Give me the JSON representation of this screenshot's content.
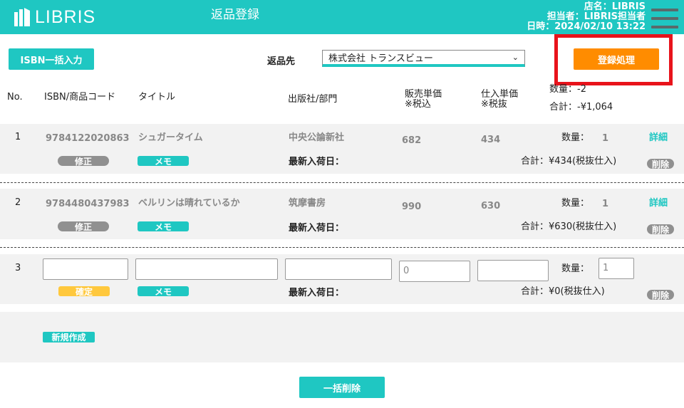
{
  "header": {
    "logo_text": "LIBRIS",
    "title": "返品登録",
    "store": "店名：LIBRIS",
    "staff": "担当者：LIBRIS担当者",
    "datetime": "日時：2024/02/10  13:22"
  },
  "controls": {
    "isbn_bulk_label": "ISBN一括入力",
    "return_to_label": "返品先",
    "return_to_value": "株式会社 トランスビュー",
    "register_label": "登録処理"
  },
  "summary": {
    "quantity": "数量：-2",
    "total": "合計：-¥1,064"
  },
  "columns": {
    "no": "No.",
    "isbn": "ISBN/商品コード",
    "title": "タイトル",
    "publisher": "出版社/部門",
    "sale_price_1": "販売単価",
    "sale_price_2": "※税込",
    "cost_price_1": "仕入単価",
    "cost_price_2": "※税抜"
  },
  "labels": {
    "edit": "修正",
    "memo": "メモ",
    "confirm": "確定",
    "latest_arrival": "最新入荷日：",
    "quantity": "数量：",
    "detail": "詳細",
    "delete": "削除"
  },
  "rows": [
    {
      "no": "1",
      "isbn": "9784122020863",
      "title": "シュガータイム",
      "publisher": "中央公論新社",
      "sale_price": "682",
      "cost_price": "434",
      "qty": "1",
      "total": "合計：¥434(税抜仕入)"
    },
    {
      "no": "2",
      "isbn": "9784480437983",
      "title": "ベルリンは晴れているか",
      "publisher": "筑摩書房",
      "sale_price": "990",
      "cost_price": "630",
      "qty": "1",
      "total": "合計：¥630(税抜仕入)"
    }
  ],
  "new_row": {
    "no": "3",
    "sale_price_value": "0",
    "qty_value": "1",
    "total": "合計：¥0(税抜仕入)"
  },
  "footer": {
    "new_label": "新規作成",
    "bulk_delete_label": "一括削除"
  }
}
